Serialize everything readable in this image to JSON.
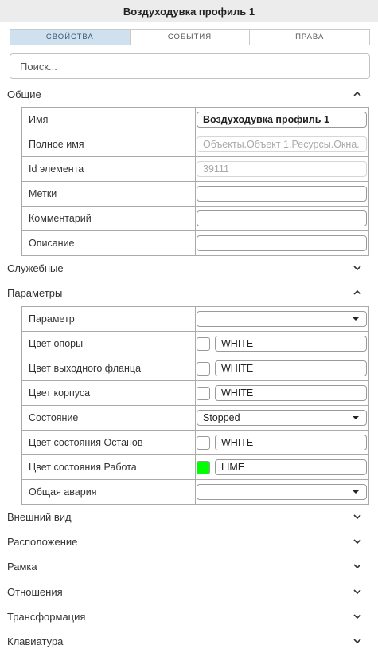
{
  "title": "Воздуходувка профиль 1",
  "tabs": [
    {
      "label": "СВОЙСТВА",
      "active": true
    },
    {
      "label": "СОБЫТИЯ",
      "active": false
    },
    {
      "label": "ПРАВА",
      "active": false
    }
  ],
  "search": {
    "placeholder": "Поиск...",
    "value": ""
  },
  "sections": {
    "general": {
      "label": "Общие",
      "expanded": true
    },
    "service": {
      "label": "Служебные",
      "expanded": false
    },
    "params": {
      "label": "Параметры",
      "expanded": true
    },
    "appearance": {
      "label": "Внешний вид",
      "expanded": false
    },
    "layout": {
      "label": "Расположение",
      "expanded": false
    },
    "frame": {
      "label": "Рамка",
      "expanded": false
    },
    "relations": {
      "label": "Отношения",
      "expanded": false
    },
    "transform": {
      "label": "Трансформация",
      "expanded": false
    },
    "keyboard": {
      "label": "Клавиатура",
      "expanded": false
    }
  },
  "general": {
    "name_label": "Имя",
    "name_value": "Воздуходувка профиль 1",
    "fullname_label": "Полное имя",
    "fullname_value": "Объекты.Объект 1.Ресурсы.Окна.",
    "id_label": "Id элемента",
    "id_value": "39111",
    "tags_label": "Метки",
    "tags_value": "",
    "comment_label": "Комментарий",
    "comment_value": "",
    "description_label": "Описание",
    "description_value": ""
  },
  "params": {
    "param_label": "Параметр",
    "param_value": "",
    "support_color_label": "Цвет опоры",
    "support_color_value": "WHITE",
    "support_color_hex": "#ffffff",
    "flange_color_label": "Цвет выходного фланца",
    "flange_color_value": "WHITE",
    "flange_color_hex": "#ffffff",
    "body_color_label": "Цвет корпуса",
    "body_color_value": "WHITE",
    "body_color_hex": "#ffffff",
    "state_label": "Состояние",
    "state_value": "Stopped",
    "stop_color_label": "Цвет состояния Останов",
    "stop_color_value": "WHITE",
    "stop_color_hex": "#ffffff",
    "run_color_label": "Цвет состояния Работа",
    "run_color_value": "LIME",
    "run_color_hex": "#00ff00",
    "alarm_label": "Общая авария",
    "alarm_value": ""
  },
  "icons": {
    "expanded": "chevron-up-icon",
    "collapsed": "chevron-down-icon",
    "dropdown": "caret-down-icon"
  }
}
